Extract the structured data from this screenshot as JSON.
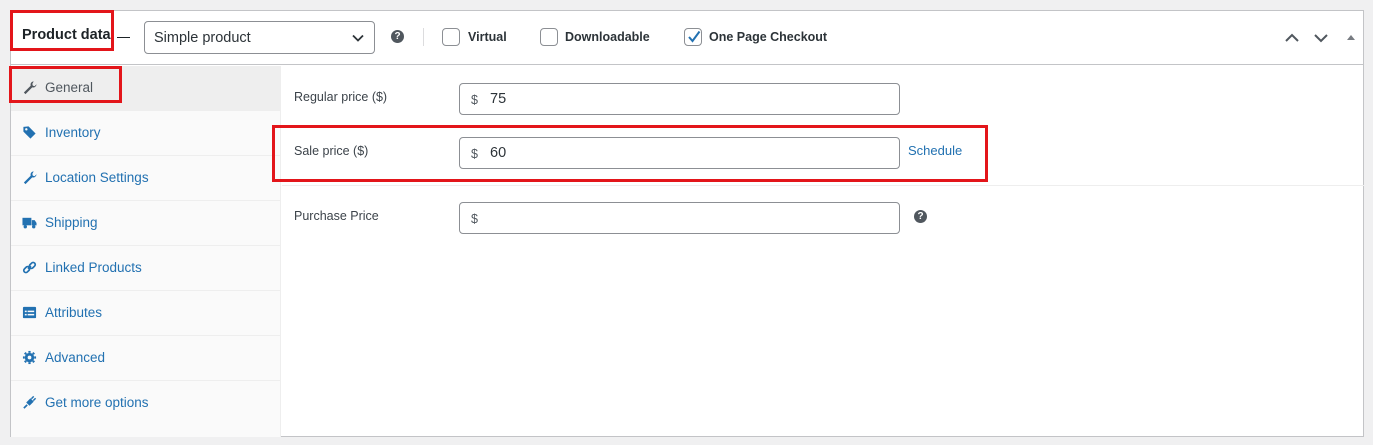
{
  "header": {
    "title": "Product data",
    "product_type": "Simple product",
    "checkboxes": [
      {
        "label": "Virtual",
        "checked": false
      },
      {
        "label": "Downloadable",
        "checked": false
      },
      {
        "label": "One Page Checkout",
        "checked": true
      }
    ],
    "help_glyph": "?"
  },
  "sidebar": {
    "items": [
      {
        "label": "General",
        "icon": "wrench-icon",
        "active": true
      },
      {
        "label": "Inventory",
        "icon": "tag-icon",
        "active": false
      },
      {
        "label": "Location Settings",
        "icon": "wrench-icon",
        "active": false
      },
      {
        "label": "Shipping",
        "icon": "truck-icon",
        "active": false
      },
      {
        "label": "Linked Products",
        "icon": "link-icon",
        "active": false
      },
      {
        "label": "Attributes",
        "icon": "list-icon",
        "active": false
      },
      {
        "label": "Advanced",
        "icon": "gear-icon",
        "active": false
      },
      {
        "label": "Get more options",
        "icon": "plugin-icon",
        "active": false
      }
    ]
  },
  "fields": {
    "currency": "$",
    "regular_price": {
      "label": "Regular price ($)",
      "value": "75"
    },
    "sale_price": {
      "label": "Sale price ($)",
      "value": "60",
      "schedule_label": "Schedule"
    },
    "purchase_price": {
      "label": "Purchase Price",
      "value": ""
    }
  },
  "colors": {
    "link": "#2271b1",
    "annotation": "#e3151a",
    "check": "#2271b1"
  }
}
